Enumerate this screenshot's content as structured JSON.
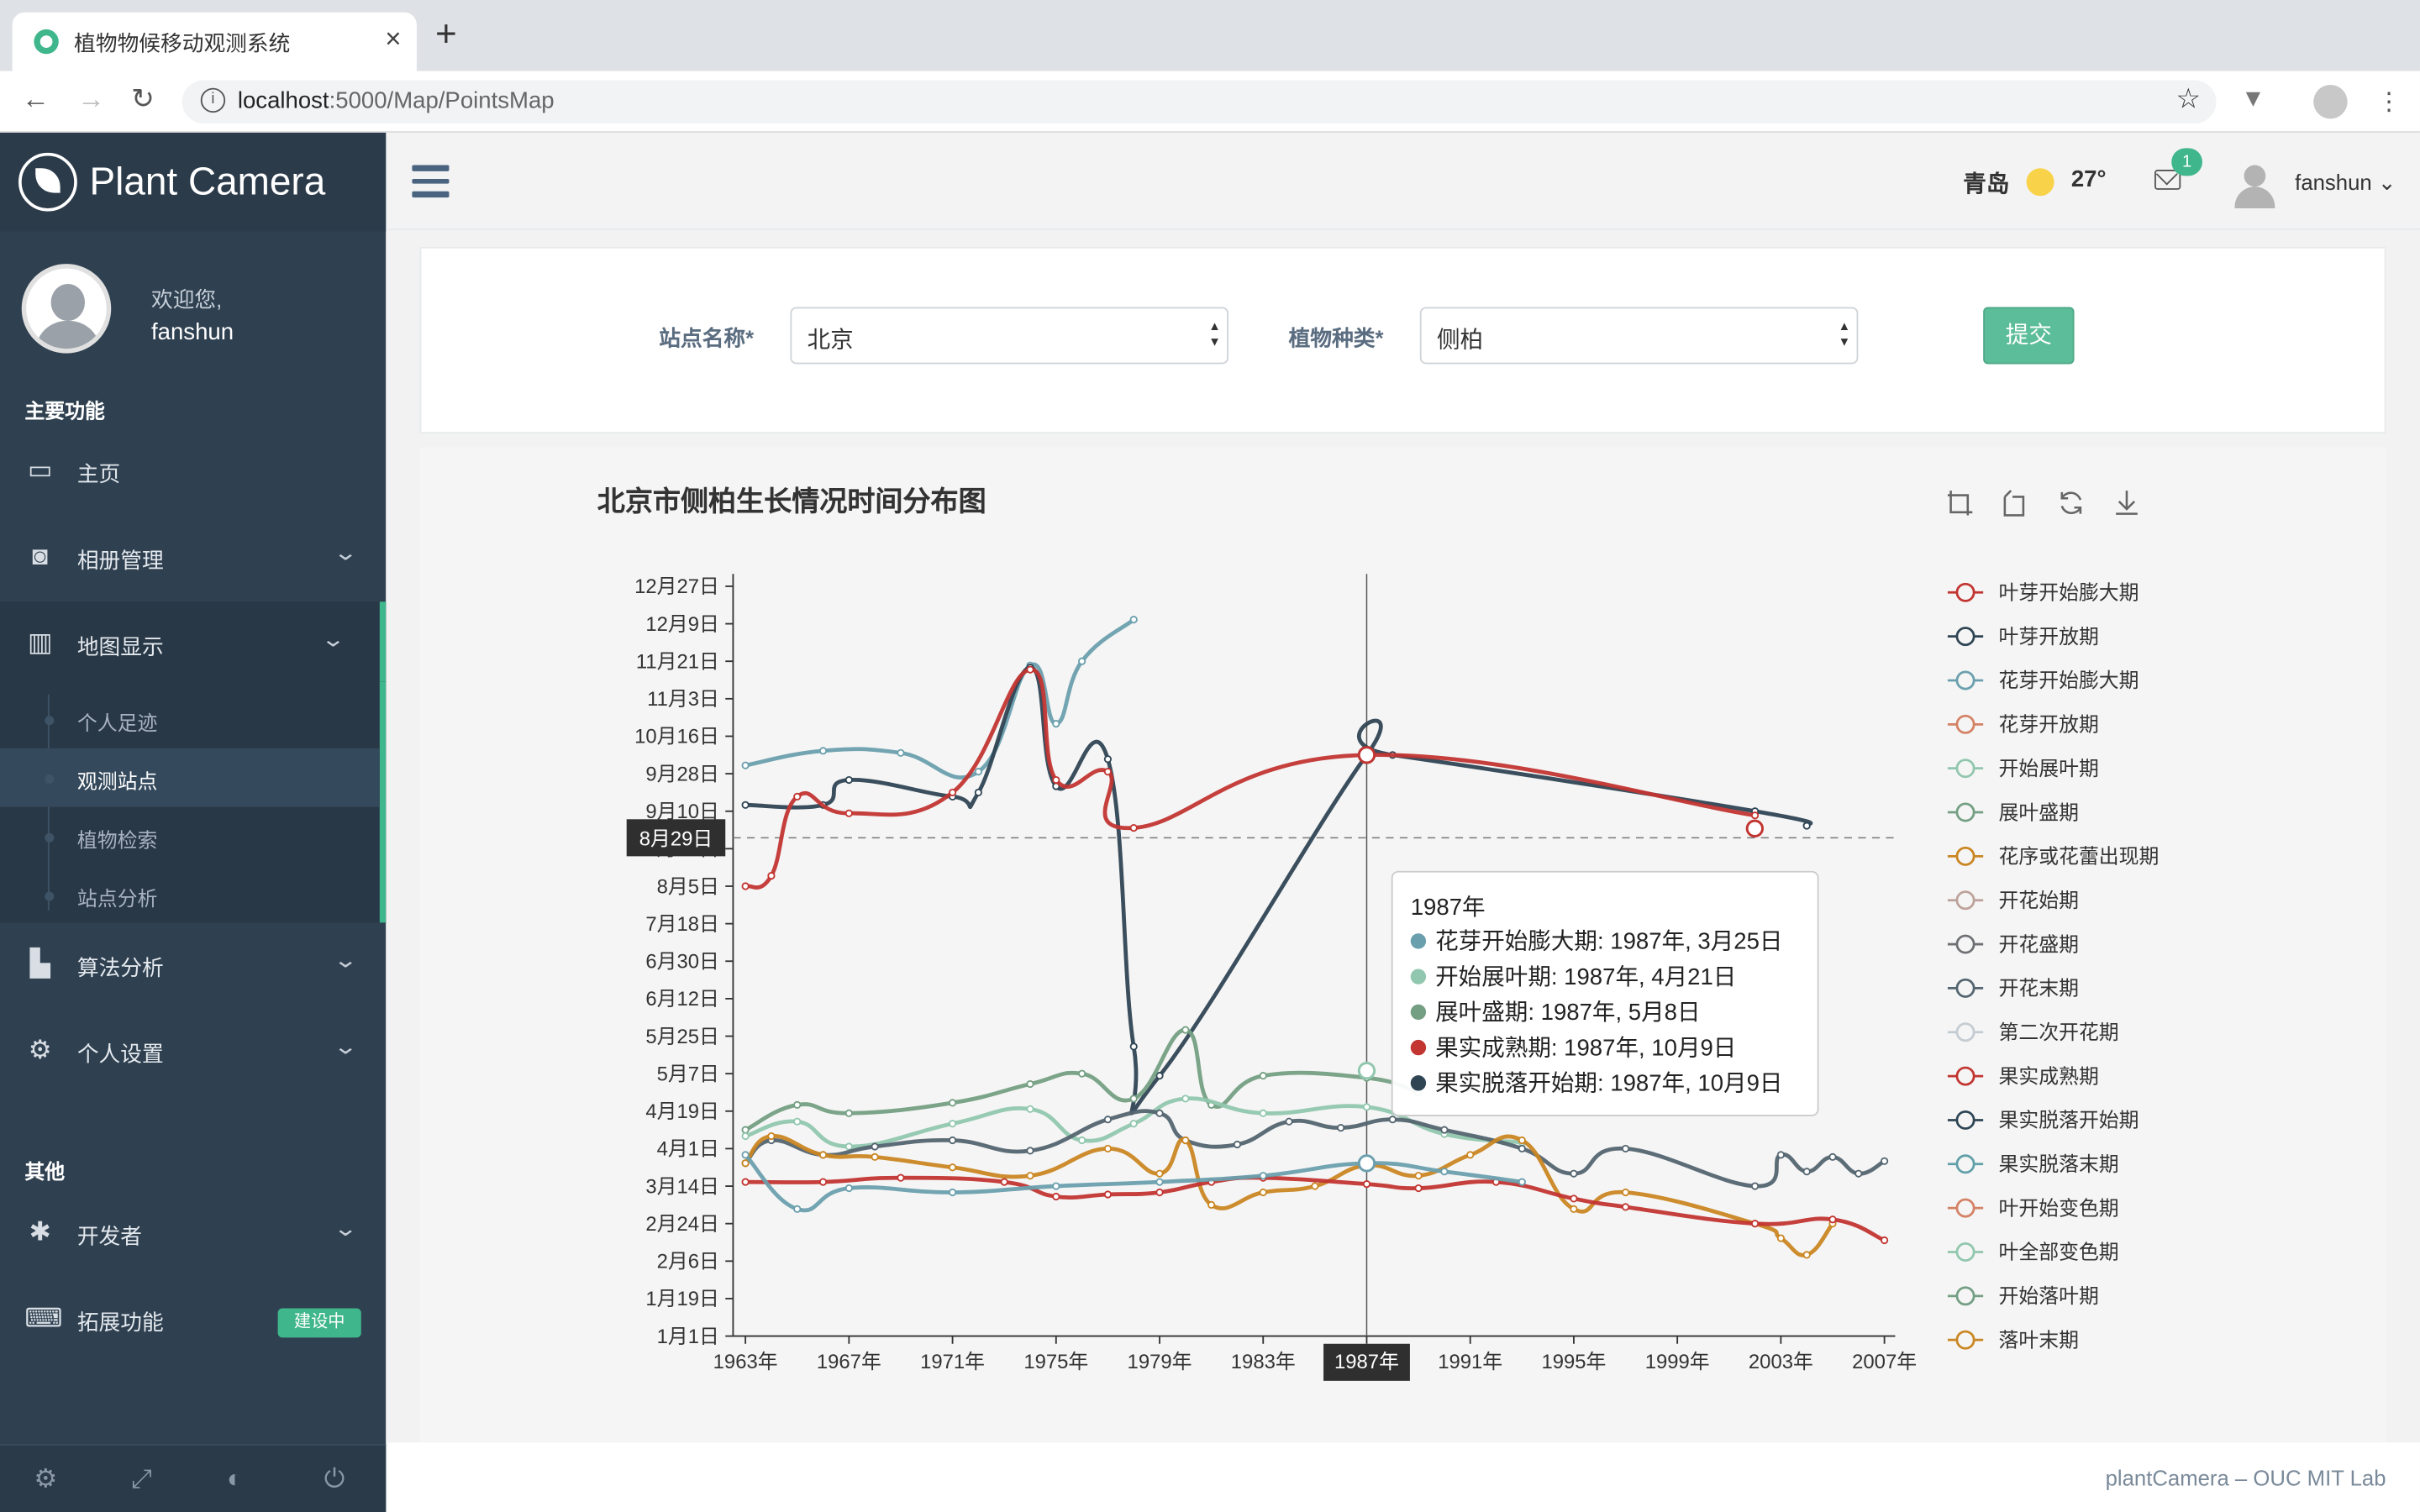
{
  "browser": {
    "tab_title": "植物物候移动观测系统",
    "url_host": "localhost",
    "url_path": ":5000/Map/PointsMap"
  },
  "sidebar": {
    "app_name": "Plant Camera",
    "welcome": "欢迎您,",
    "user": "fanshun",
    "section_main": "主要功能",
    "section_other": "其他",
    "items": [
      {
        "label": "主页",
        "icon": "monitor-icon"
      },
      {
        "label": "相册管理",
        "icon": "camera-icon"
      },
      {
        "label": "地图显示",
        "icon": "map-icon"
      },
      {
        "label": "算法分析",
        "icon": "bar-chart-icon"
      },
      {
        "label": "个人设置",
        "icon": "gears-icon"
      },
      {
        "label": "开发者",
        "icon": "bug-icon"
      },
      {
        "label": "拓展功能",
        "icon": "laptop-icon"
      }
    ],
    "subitems": [
      "个人足迹",
      "观测站点",
      "植物检索",
      "站点分析"
    ],
    "extension_badge": "建设中"
  },
  "header": {
    "city": "青岛",
    "temperature": "27°",
    "mail_count": "1",
    "user": "fanshun"
  },
  "form": {
    "station_label": "站点名称*",
    "station_value": "北京",
    "species_label": "植物种类*",
    "species_value": "侧柏",
    "submit": "提交"
  },
  "footer": "plantCamera – OUC MIT Lab",
  "colors": {
    "accent": "#3fb68b",
    "sidebar": "#2f4050"
  },
  "chart_data": {
    "type": "line",
    "title": "北京市侧柏生长情况时间分布图",
    "x_ticks": [
      "1963年",
      "1967年",
      "1971年",
      "1975年",
      "1979年",
      "1983年",
      "1987年",
      "1991年",
      "1995年",
      "1999年",
      "2003年",
      "2007年"
    ],
    "y_ticks": [
      "1月1日",
      "1月19日",
      "2月6日",
      "2月24日",
      "3月14日",
      "4月1日",
      "4月19日",
      "5月7日",
      "5月25日",
      "6月12日",
      "6月30日",
      "7月18日",
      "8月5日",
      "8月23日",
      "9月10日",
      "9月28日",
      "10月16日",
      "11月3日",
      "11月21日",
      "12月9日",
      "12月27日"
    ],
    "ylim_day": [
      1,
      361
    ],
    "crosshair": {
      "x": 1987,
      "x_label": "1987年",
      "y_label": "8月29日"
    },
    "legend": [
      "叶芽开始膨大期",
      "叶芽开放期",
      "花芽开始膨大期",
      "花芽开放期",
      "开始展叶期",
      "展叶盛期",
      "花序或花蕾出现期",
      "开花始期",
      "开花盛期",
      "开花末期",
      "第二次开花期",
      "果实成熟期",
      "果实脱落开始期",
      "果实脱落末期",
      "叶开始变色期",
      "叶全部变色期",
      "开始落叶期",
      "落叶末期"
    ],
    "series": [
      {
        "name": "花芽开始膨大期",
        "color": "#6a9fad",
        "x": [
          1963,
          1966,
          1969,
          1972,
          1974,
          1975,
          1976,
          1978
        ],
        "y": [
          275,
          282,
          281,
          272,
          323,
          295,
          325,
          345
        ]
      },
      {
        "name": "叶芽开放期",
        "color": "#2f4554",
        "x": [
          1963,
          1966,
          1967,
          1971,
          1972,
          1974,
          1975,
          1977,
          1978,
          1979,
          1987,
          1988,
          2002,
          2004
        ],
        "y": [
          256,
          256,
          268,
          260,
          262,
          322,
          265,
          278,
          140,
          126,
          280,
          280,
          253,
          246
        ]
      },
      {
        "name": "果实成熟期",
        "color": "#c23531",
        "x": [
          1963,
          1964,
          1965,
          1967,
          1971,
          1974,
          1975,
          1977,
          1978,
          1987,
          2002
        ],
        "y": [
          217,
          222,
          260,
          252,
          262,
          321,
          268,
          272,
          245,
          280,
          251
        ]
      },
      {
        "name": "展叶盛期",
        "color": "#749f83",
        "x": [
          1963,
          1965,
          1967,
          1971,
          1974,
          1976,
          1978,
          1980,
          1981,
          1983,
          1987,
          1989
        ],
        "y": [
          100,
          112,
          108,
          113,
          122,
          127,
          115,
          148,
          112,
          126,
          125,
          118
        ]
      },
      {
        "name": "开始展叶期",
        "color": "#91c7ae",
        "x": [
          1963,
          1965,
          1967,
          1971,
          1974,
          1976,
          1978,
          1980,
          1983,
          1987,
          1990,
          1993
        ],
        "y": [
          97,
          104,
          92,
          103,
          110,
          95,
          103,
          115,
          108,
          111,
          98,
          94
        ]
      },
      {
        "name": "开花盛期",
        "color": "#546570",
        "x": [
          1963,
          1964,
          1966,
          1968,
          1971,
          1974,
          1977,
          1979,
          1980,
          1982,
          1984,
          1986,
          1988,
          1990,
          1993,
          1995,
          1997,
          2002,
          2003,
          2004,
          2005,
          2006,
          2007
        ],
        "y": [
          84,
          95,
          88,
          92,
          95,
          90,
          105,
          108,
          95,
          93,
          104,
          101,
          105,
          100,
          91,
          79,
          91,
          73,
          88,
          80,
          87,
          79,
          85
        ]
      },
      {
        "name": "花芽开放期",
        "color": "#ca8622",
        "x": [
          1963,
          1964,
          1966,
          1968,
          1971,
          1974,
          1977,
          1979,
          1980,
          1981,
          1983,
          1985,
          1987,
          1989,
          1991,
          1993,
          1995,
          1997,
          2002,
          2003,
          2004,
          2005
        ],
        "y": [
          84,
          97,
          88,
          87,
          82,
          78,
          91,
          79,
          95,
          64,
          70,
          73,
          83,
          78,
          88,
          95,
          62,
          70,
          55,
          48,
          40,
          55
        ]
      },
      {
        "name": "叶芽开始膨大期",
        "color": "#c23531",
        "x": [
          1963,
          1966,
          1969,
          1973,
          1975,
          1977,
          1979,
          1981,
          1983,
          1987,
          1989,
          1992,
          1995,
          1997,
          2002,
          2005,
          2007
        ],
        "y": [
          75,
          75,
          77,
          75,
          68,
          69,
          70,
          75,
          77,
          74,
          72,
          75,
          67,
          63,
          55,
          57,
          47
        ]
      },
      {
        "name": "果实脱落末期",
        "color": "#6a9fad",
        "x": [
          1963,
          1965,
          1967,
          1971,
          1975,
          1979,
          1983,
          1987,
          1990,
          1993
        ],
        "y": [
          88,
          62,
          72,
          70,
          73,
          75,
          78,
          84,
          80,
          75
        ]
      }
    ],
    "tooltip": {
      "title": "1987年",
      "rows": [
        {
          "label": "花芽开始膨大期: 1987年, 3月25日",
          "color": "#6a9fad"
        },
        {
          "label": "开始展叶期: 1987年, 4月21日",
          "color": "#91c7ae"
        },
        {
          "label": "展叶盛期: 1987年, 5月8日",
          "color": "#749f83"
        },
        {
          "label": "果实成熟期: 1987年, 10月9日",
          "color": "#c23531"
        },
        {
          "label": "果实脱落开始期: 1987年, 10月9日",
          "color": "#2f4554"
        }
      ]
    }
  }
}
